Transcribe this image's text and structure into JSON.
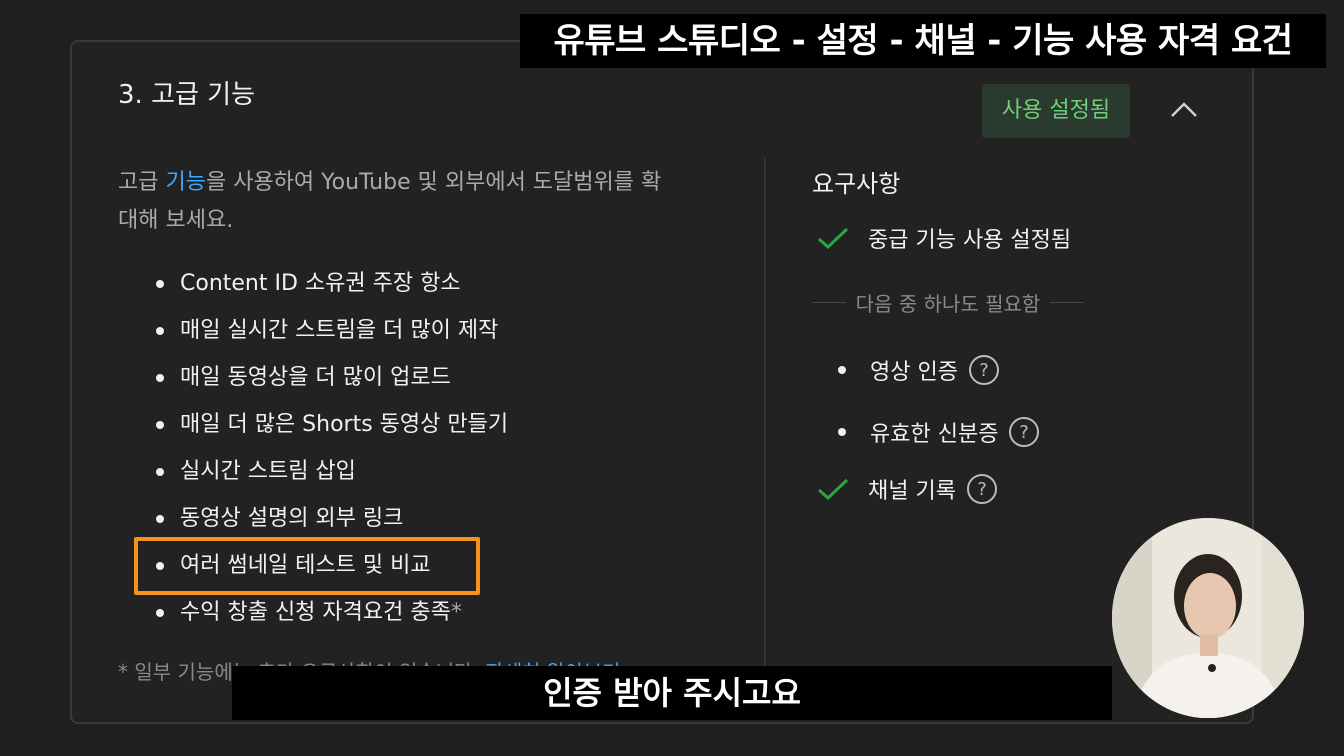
{
  "overlay_title": "유튜브 스튜디오 - 설정 - 채널 - 기능 사용 자격 요건",
  "section": {
    "title": "3. 고급 기능",
    "status_badge": "사용 설정됨",
    "collapse_icon": "chevron-up-icon"
  },
  "intro": {
    "prefix": "고급 ",
    "link": "기능",
    "line1_rest": "을 사용하여 YouTube 및 외부에서 도달범위를 확",
    "line2": "대해 보세요."
  },
  "features": [
    "Content ID 소유권 주장 항소",
    "매일 실시간 스트림을 더 많이 제작",
    "매일 동영상을 더 많이 업로드",
    "매일 더 많은 Shorts 동영상 만들기",
    "실시간 스트림 삽입",
    "동영상 설명의 외부 링크",
    "여러 썸네일 테스트 및 비교",
    "수익 창출 신청 자격요건 충족"
  ],
  "feature_asterisk": "*",
  "footnote": {
    "text": "* 일부 기능에는 추가 요구사항이 있습니다. ",
    "link": "자세히 알아보기"
  },
  "requirements": {
    "title": "요구사항",
    "met": "중급 기능 사용 설정됨",
    "separator": "다음 중 하나도 필요함",
    "options": [
      {
        "label": "영상 인증",
        "state": "bullet"
      },
      {
        "label": "유효한 신분증",
        "state": "bullet"
      },
      {
        "label": "채널 기록",
        "state": "check"
      }
    ],
    "check_color": "#2ba640"
  },
  "highlight_color": "#f5921e",
  "subtitle": "인증 받아 주시고요"
}
